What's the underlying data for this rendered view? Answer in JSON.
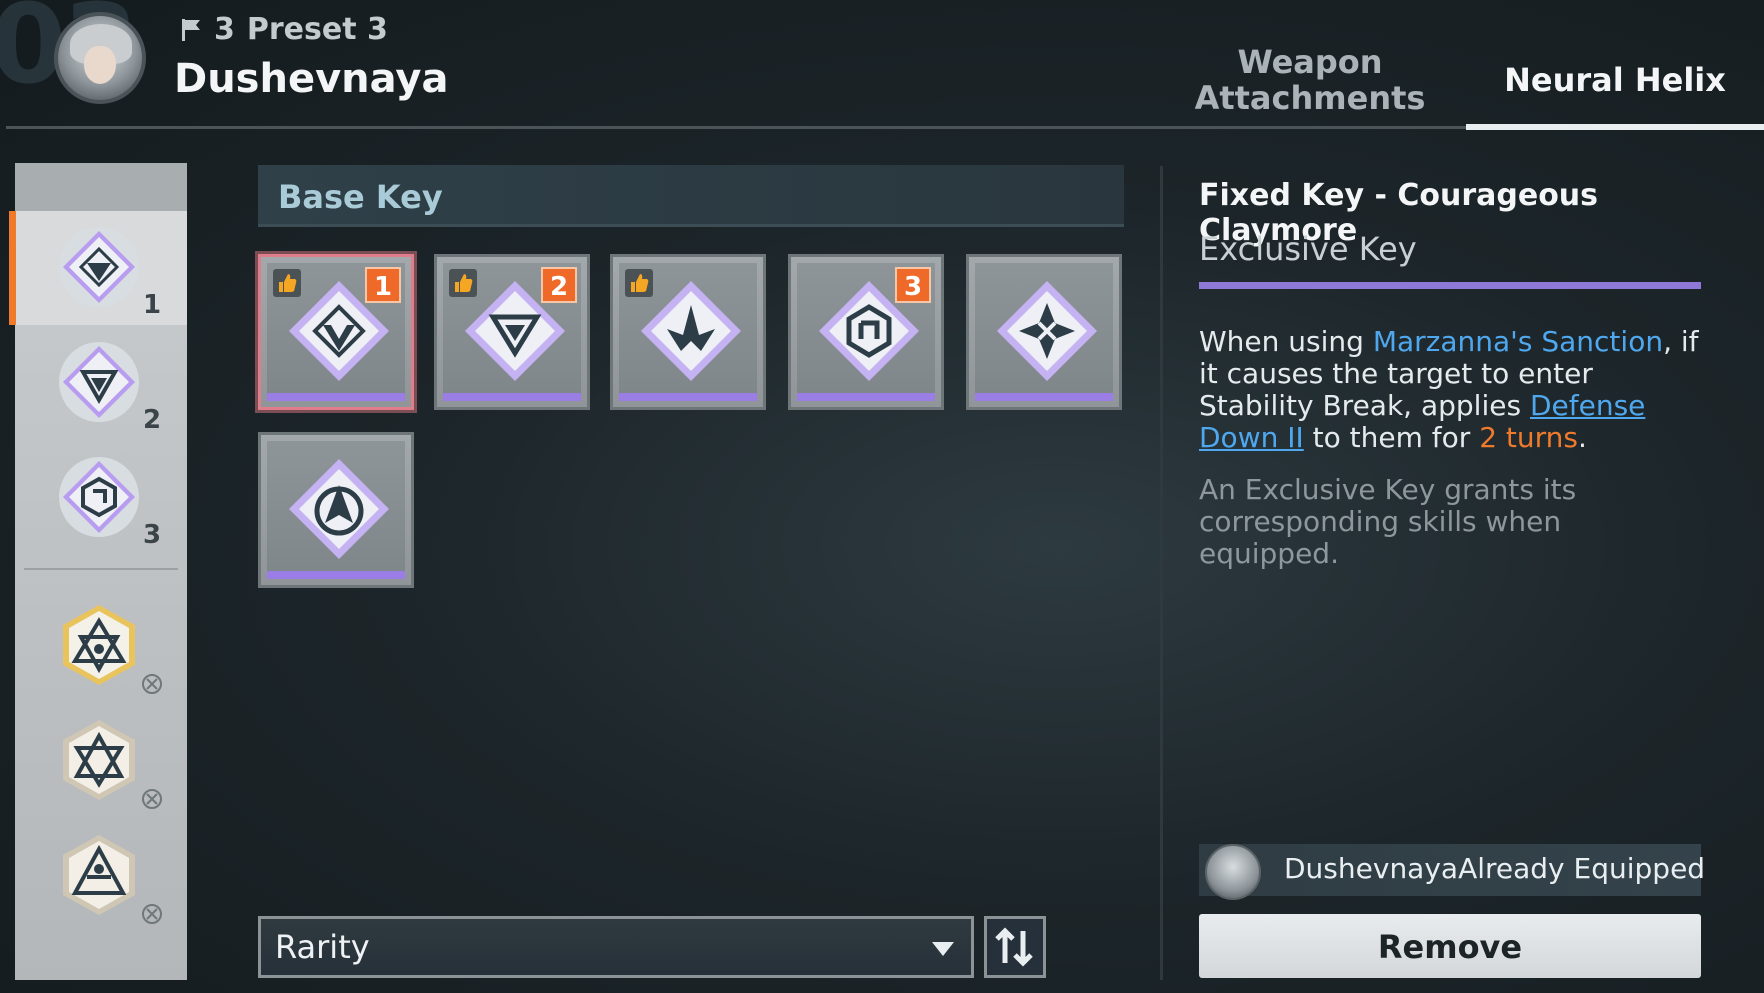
{
  "header": {
    "background_number": "03",
    "preset_number": "3",
    "preset_name": "Preset 3",
    "character_name": "Dushevnaya",
    "tabs": [
      {
        "label": "Weapon Attachments",
        "active": false
      },
      {
        "label": "Neural Helix",
        "active": true
      }
    ]
  },
  "sidebar": {
    "slots": [
      {
        "number": "1",
        "icon": "key-triangle-icon",
        "selected": true
      },
      {
        "number": "2",
        "icon": "key-chevron-icon",
        "selected": false
      },
      {
        "number": "3",
        "icon": "key-hexlink-icon",
        "selected": false
      }
    ],
    "extra_slots": [
      {
        "icon": "gold-key-icon",
        "locked": true
      },
      {
        "icon": "star-key-icon",
        "locked": true
      },
      {
        "icon": "star-key-icon",
        "locked": true
      }
    ]
  },
  "base_key": {
    "title": "Base Key",
    "cards": [
      {
        "icon": "key-triangle-icon",
        "recommended": true,
        "badge": "1",
        "selected": true
      },
      {
        "icon": "key-chevron-icon",
        "recommended": true,
        "badge": "2",
        "selected": false
      },
      {
        "icon": "key-spike-icon",
        "recommended": true,
        "badge": "",
        "selected": false
      },
      {
        "icon": "key-hexlink-icon",
        "recommended": false,
        "badge": "3",
        "selected": false
      },
      {
        "icon": "key-compass-icon",
        "recommended": false,
        "badge": "",
        "selected": false
      },
      {
        "icon": "key-arc-icon",
        "recommended": false,
        "badge": "",
        "selected": false
      }
    ]
  },
  "sort": {
    "label": "Rarity",
    "order_icon": "sort-order-icon"
  },
  "detail": {
    "title": "Fixed Key - Courageous Claymore",
    "subtitle": "Exclusive Key",
    "desc_part1": "When using ",
    "skill_name": "Marzanna's Sanction",
    "desc_part2": ", if it causes the target to enter Stability Break, applies ",
    "effect_name": "Defense Down II",
    "desc_part3": " to them for ",
    "duration": "2 turns",
    "desc_part4": ".",
    "note": "An Exclusive Key grants its corresponding skills when equipped.",
    "equipped_text": "DushevnayaAlready Equipped",
    "remove_label": "Remove"
  },
  "colors": {
    "accent_orange": "#f07a2c",
    "rarity_purple": "#9b7de6",
    "link_blue": "#4fa8ee"
  }
}
